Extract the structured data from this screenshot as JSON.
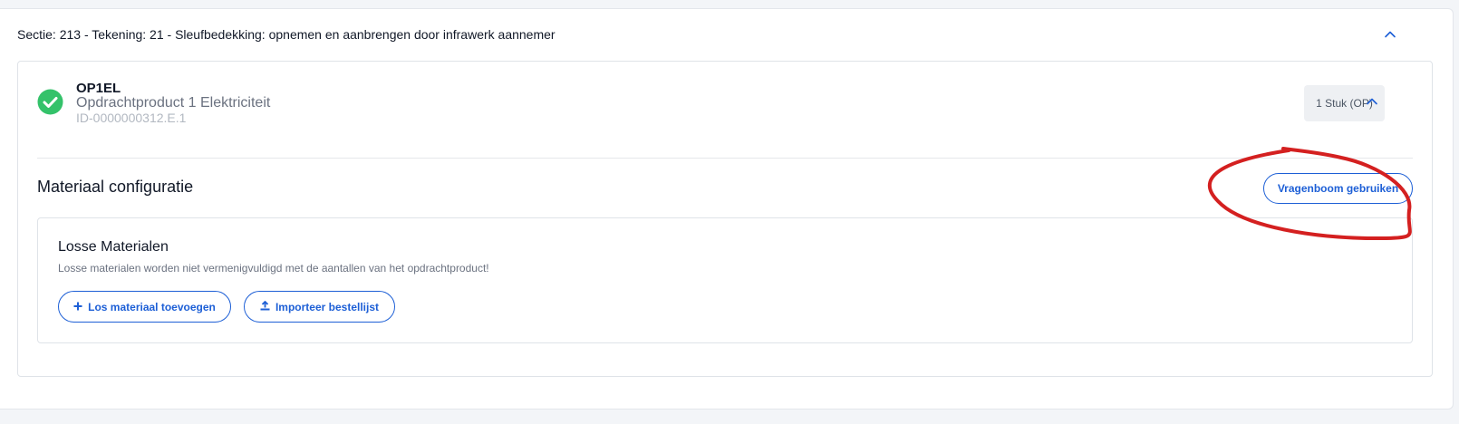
{
  "section": {
    "title": "Sectie: 213 - Tekening: 21 - Sleufbedekking: opnemen en aanbrengen door infrawerk aannemer"
  },
  "product": {
    "code": "OP1EL",
    "name": "Opdrachtproduct 1 Elektriciteit",
    "id": "ID-0000000312.E.1",
    "quantity_badge": "1 Stuk (OP)",
    "status_icon": "check-circle-icon"
  },
  "config": {
    "title": "Materiaal configuratie",
    "vragenboom_button": "Vragenboom gebruiken"
  },
  "losse": {
    "title": "Losse Materialen",
    "subtitle": "Losse materialen worden niet vermenigvuldigd met de aantallen van het opdrachtproduct!",
    "add_button": "Los materiaal toevoegen",
    "import_button": "Importeer bestellijst"
  },
  "colors": {
    "accent": "#1d5fd6",
    "success": "#34c26a",
    "annotation": "#d42020"
  }
}
